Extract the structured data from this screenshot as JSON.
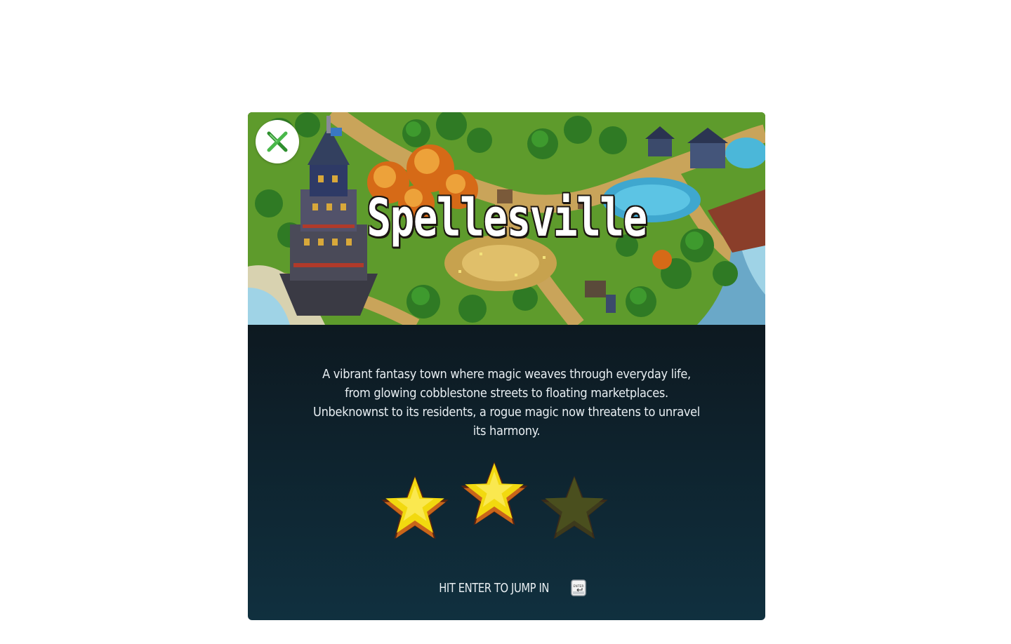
{
  "level": {
    "title": "Spellesville",
    "description": "A vibrant fantasy town where magic weaves through everyday life, from glowing cobblestone streets to floating marketplaces. Unbeknownst to its residents, a rogue magic now threatens to unravel its harmony.",
    "rating": {
      "earned": 2,
      "total": 3
    }
  },
  "actions": {
    "enter_hint": "HIT ENTER TO JUMP IN",
    "enter_key_label": "ENTER"
  },
  "icons": {
    "close": "close-icon",
    "star": "star-icon",
    "enter_key": "enter-key-icon"
  },
  "colors": {
    "close_accent": "#3aa63a",
    "star_filled": "#f2d90f",
    "star_empty": "#4a4f1e",
    "panel_top": "#0b0d0f",
    "panel_bottom": "#10303f"
  }
}
